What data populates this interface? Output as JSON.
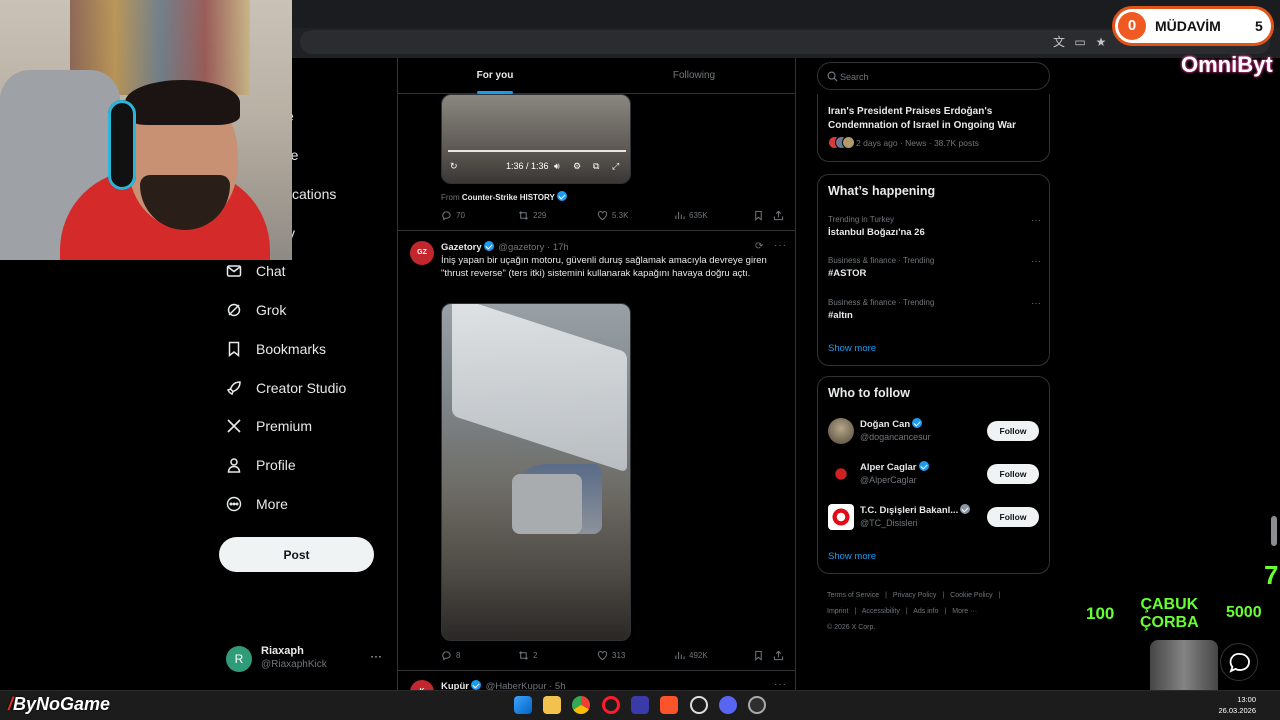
{
  "overlay": {
    "mudavim": {
      "left_count": "0",
      "label": "MÜDAVİM",
      "right_count": "5"
    },
    "channel_name": "OmniByt",
    "score_100": "100",
    "reward_title": "ÇABUK\nÇORBA",
    "score_5000": "5000",
    "side_digit": "7",
    "brand": "ByNoGame"
  },
  "leftnav": {
    "partial_items": [
      "e",
      "re",
      "cations",
      "y"
    ],
    "items": [
      {
        "label": "Chat",
        "icon": "mail-icon"
      },
      {
        "label": "Grok",
        "icon": "grok-icon"
      },
      {
        "label": "Bookmarks",
        "icon": "bookmark-icon"
      },
      {
        "label": "Creator Studio",
        "icon": "rocket-icon"
      },
      {
        "label": "Premium",
        "icon": "x-logo-icon"
      },
      {
        "label": "Profile",
        "icon": "person-icon"
      },
      {
        "label": "More",
        "icon": "more-circle-icon"
      }
    ],
    "post_label": "Post",
    "account": {
      "initial": "R",
      "name": "Riaxaph",
      "handle": "@RiaxaphKick",
      "more": "···"
    }
  },
  "timeline": {
    "tabs": [
      {
        "label": "For you"
      },
      {
        "label": "Following"
      }
    ],
    "tweet1": {
      "video_time": "1:36 / 1:36",
      "from_prefix": "From",
      "from_name": "Counter-Strike HISTORY",
      "replies": "70",
      "reposts": "229",
      "likes": "5.3K",
      "views": "635K"
    },
    "tweet2": {
      "avatar_text": "GZ",
      "name": "Gazetory",
      "handle_time": "@gazetory · 17h",
      "text": "İniş yapan bir uçağın motoru, güvenli duruş sağlamak amacıyla devreye giren \"thrust reverse\" (ters itki) sistemini kullanarak kapağını havaya doğru açtı.",
      "replies": "8",
      "reposts": "2",
      "likes": "313",
      "views": "492K"
    },
    "tweet3": {
      "avatar_text": "K",
      "name": "Kupür",
      "handle_time": "@HaberKupur · 5h"
    }
  },
  "right": {
    "search_placeholder": "Search",
    "news": {
      "title": "Iran's President Praises Erdoğan's Condemnation of Israel in Ongoing War",
      "meta": "2 days ago · News · 38.7K posts"
    },
    "happening": {
      "title": "What’s happening",
      "trends": [
        {
          "category": "Trending in Turkey",
          "name": "İstanbul Boğazı'na 26"
        },
        {
          "category": "Business & finance · Trending",
          "name": "#ASTOR"
        },
        {
          "category": "Business & finance · Trending",
          "name": "#altın"
        }
      ],
      "show_more": "Show more"
    },
    "who_to_follow": {
      "title": "Who to follow",
      "accounts": [
        {
          "name": "Doğan Can",
          "handle": "@dogancancesur",
          "button": "Follow"
        },
        {
          "name": "Alper Caglar",
          "handle": "@AlperCaglar",
          "button": "Follow"
        },
        {
          "name": "T.C. Dışişleri Bakanl...",
          "handle": "@TC_Disisleri",
          "button": "Follow"
        }
      ],
      "show_more": "Show more"
    },
    "footer": {
      "links": [
        "Terms of Service",
        "|",
        "Privacy Policy",
        "|",
        "Cookie Policy",
        "|",
        "Imprint",
        "|",
        "Accessibility",
        "|",
        "Ads info",
        "|",
        "More ···"
      ],
      "copyright": "© 2026 X Corp."
    }
  },
  "taskbar": {
    "time": "13:00",
    "date": "26.03.2026"
  },
  "colors": {
    "accent": "#1d9bf0",
    "background": "#000000",
    "border": "#2f3336",
    "muted": "#71767b"
  }
}
